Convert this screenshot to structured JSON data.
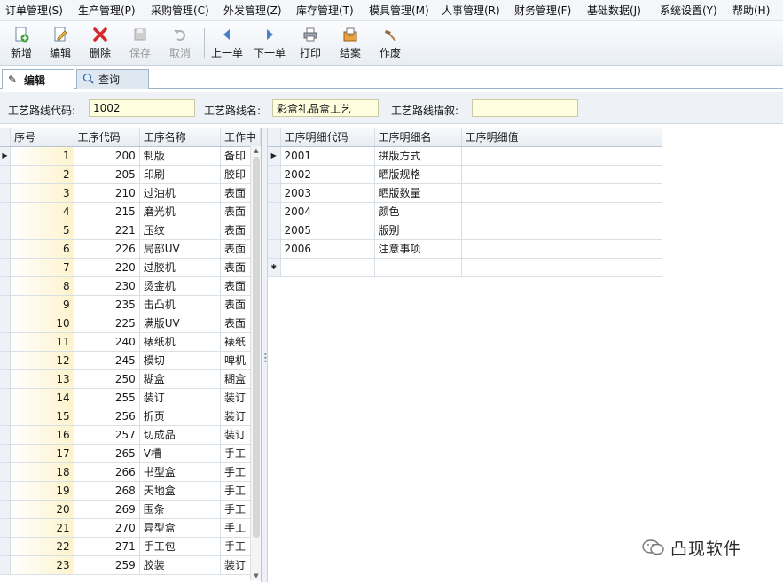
{
  "menu": [
    "订单管理(S)",
    "生产管理(P)",
    "采购管理(C)",
    "外发管理(Z)",
    "库存管理(T)",
    "模具管理(M)",
    "人事管理(R)",
    "财务管理(F)",
    "基础数据(J)",
    "系统设置(Y)",
    "帮助(H)"
  ],
  "toolbar": {
    "new": "新增",
    "edit": "编辑",
    "delete": "删除",
    "save": "保存",
    "cancel": "取消",
    "prev": "上一单",
    "next": "下一单",
    "print": "打印",
    "close_case": "结案",
    "void": "作废"
  },
  "tabs": {
    "edit": "编辑",
    "query": "查询"
  },
  "form": {
    "route_code_label": "工艺路线代码:",
    "route_code_value": "1002",
    "route_name_label": "工艺路线名:",
    "route_name_value": "彩盒礼品盒工艺",
    "route_desc_label": "工艺路线描叙:",
    "route_desc_value": ""
  },
  "left_grid": {
    "headers": [
      "序号",
      "工序代码",
      "工序名称",
      "工作中"
    ],
    "rows": [
      [
        "1",
        "200",
        "制版",
        "备印"
      ],
      [
        "2",
        "205",
        "印刷",
        "胶印"
      ],
      [
        "3",
        "210",
        "过油机",
        "表面"
      ],
      [
        "4",
        "215",
        "磨光机",
        "表面"
      ],
      [
        "5",
        "221",
        "压纹",
        "表面"
      ],
      [
        "6",
        "226",
        "局部UV",
        "表面"
      ],
      [
        "7",
        "220",
        "过胶机",
        "表面"
      ],
      [
        "8",
        "230",
        "烫金机",
        "表面"
      ],
      [
        "9",
        "235",
        "击凸机",
        "表面"
      ],
      [
        "10",
        "225",
        "满版UV",
        "表面"
      ],
      [
        "11",
        "240",
        "裱纸机",
        "裱纸"
      ],
      [
        "12",
        "245",
        "模切",
        "啤机"
      ],
      [
        "13",
        "250",
        "糊盒",
        "糊盒"
      ],
      [
        "14",
        "255",
        "装订",
        "装订"
      ],
      [
        "15",
        "256",
        "折页",
        "装订"
      ],
      [
        "16",
        "257",
        "切成品",
        "装订"
      ],
      [
        "17",
        "265",
        "V槽",
        "手工"
      ],
      [
        "18",
        "266",
        "书型盒",
        "手工"
      ],
      [
        "19",
        "268",
        "天地盒",
        "手工"
      ],
      [
        "20",
        "269",
        "围条",
        "手工"
      ],
      [
        "21",
        "270",
        "异型盒",
        "手工"
      ],
      [
        "22",
        "271",
        "手工包",
        "手工"
      ],
      [
        "23",
        "259",
        "胶装",
        "装订"
      ]
    ]
  },
  "right_grid": {
    "headers": [
      "工序明细代码",
      "工序明细名",
      "工序明细值"
    ],
    "rows": [
      [
        "2001",
        "拼版方式",
        ""
      ],
      [
        "2002",
        "晒版规格",
        ""
      ],
      [
        "2003",
        "晒版数量",
        ""
      ],
      [
        "2004",
        "颜色",
        ""
      ],
      [
        "2005",
        "版别",
        ""
      ],
      [
        "2006",
        "注意事项",
        ""
      ]
    ]
  },
  "watermark": "凸现软件",
  "colors": {
    "input_bg": "#ffffe0",
    "header_bg": "#e8edf3",
    "toolbar_bg": "#e9eef4"
  }
}
